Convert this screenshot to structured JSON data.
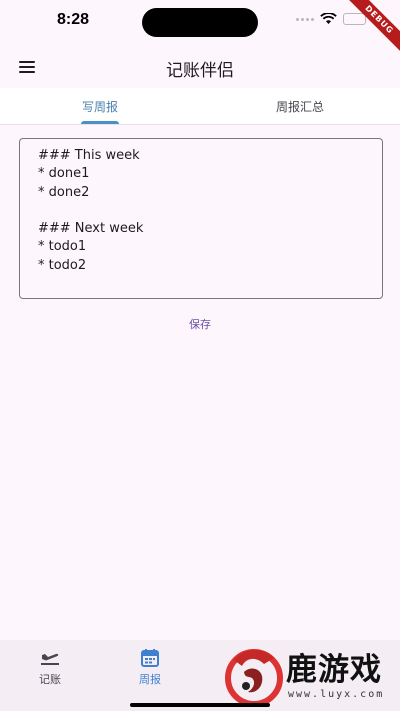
{
  "status_bar": {
    "time": "8:28",
    "debug_label": "DEBUG"
  },
  "app_bar": {
    "title": "记账伴侣",
    "menu_icon": "menu-icon"
  },
  "tabs": [
    {
      "label": "写周报",
      "active": true
    },
    {
      "label": "周报汇总",
      "active": false
    }
  ],
  "editor": {
    "value": "### This week\n* done1\n* done2\n\n### Next week\n* todo1\n* todo2"
  },
  "save_button": {
    "label": "保存"
  },
  "bottom_nav": {
    "items": [
      {
        "label": "记账",
        "icon": "flight-icon",
        "active": false
      },
      {
        "label": "周报",
        "active": true,
        "icon": "calendar-icon"
      },
      {
        "label": "",
        "icon": "",
        "active": false
      },
      {
        "label": "",
        "icon": "",
        "active": false
      }
    ]
  },
  "watermark": {
    "text": "鹿游戏",
    "url": "www.luyx.com"
  },
  "colors": {
    "background": "#fdf7fd",
    "accent": "#4a7fb0",
    "save": "#6750a4"
  }
}
